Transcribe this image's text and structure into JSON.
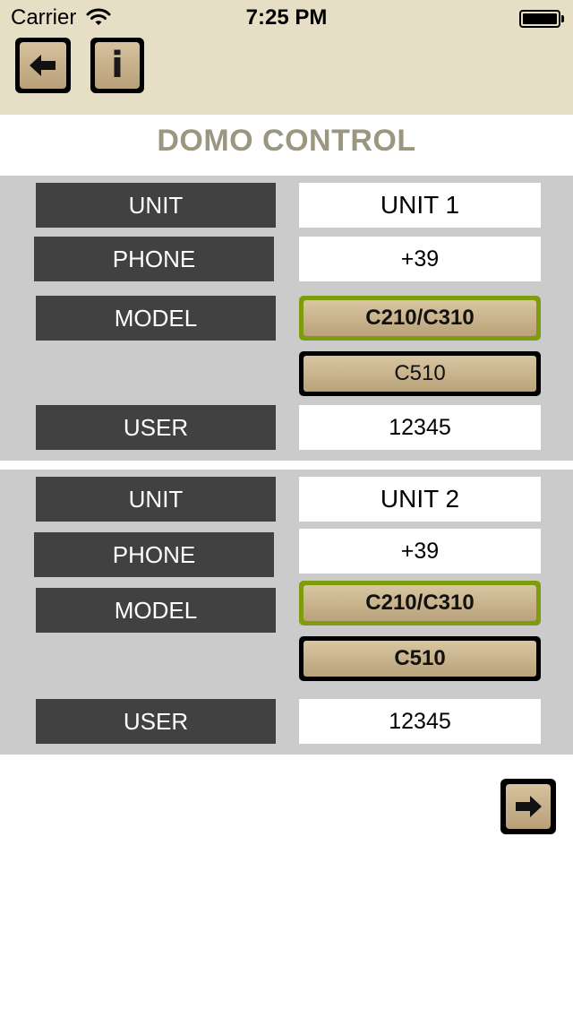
{
  "status_bar": {
    "carrier": "Carrier",
    "time": "7:25 PM",
    "wifi_icon": "wifi-icon",
    "battery_icon": "battery-icon"
  },
  "nav": {
    "back_icon": "arrow-left-icon",
    "info_label": "i"
  },
  "title": "DOMO CONTROL",
  "units": [
    {
      "unit_label": "UNIT",
      "unit_value": "UNIT 1",
      "phone_label": "PHONE",
      "phone_value": "+39",
      "model_label": "MODEL",
      "model_options": [
        "C210/C310",
        "C510"
      ],
      "user_label": "USER",
      "user_value": "12345"
    },
    {
      "unit_label": "UNIT",
      "unit_value": "UNIT 2",
      "phone_label": "PHONE",
      "phone_value": "+39",
      "model_label": "MODEL",
      "model_options": [
        "C210/C310",
        "C510"
      ],
      "user_label": "USER",
      "user_value": "12345"
    }
  ],
  "footer": {
    "next_icon": "arrow-right-icon"
  },
  "colors": {
    "header_bg": "#e6dec5",
    "section_bg": "#cbcbcb",
    "label_bg": "#414141",
    "selected_border": "#7f9c0f",
    "button_face": "#c8b48f",
    "title_text": "#9a9680"
  }
}
